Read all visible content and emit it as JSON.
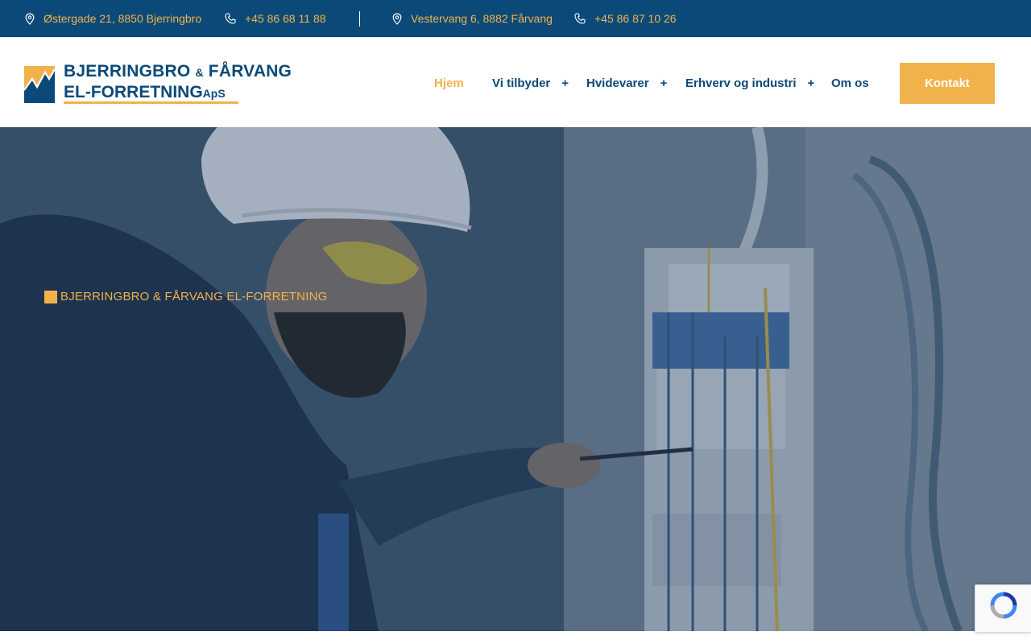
{
  "topbar": {
    "address1": "Østergade 21, 8850 Bjerringbro",
    "phone1": "+45 86 68 11 88",
    "address2": "Vestervang 6, 8882 Fårvang",
    "phone2": "+45 86 87 10 26"
  },
  "logo": {
    "line1_main": "BJERRINGBRO",
    "line1_amp": "&",
    "line1_end": "FÅRVANG",
    "line2_main": "EL-FORRETNING",
    "line2_suffix": "ApS"
  },
  "nav": {
    "items": [
      {
        "label": "Hjem",
        "active": true
      },
      {
        "label": "Vi tilbyder",
        "has_submenu": true
      },
      {
        "label": "Hvidevarer",
        "has_submenu": true
      },
      {
        "label": "Erhverv og industri",
        "has_submenu": true
      },
      {
        "label": "Om os"
      }
    ],
    "plus_symbol": "+",
    "cta_label": "Kontakt"
  },
  "hero": {
    "eyebrow": "BJERRINGBRO & FÅRVANG EL-FORRETNING"
  },
  "colors": {
    "brand_blue": "#0b4a78",
    "accent_orange": "#f2b24b"
  },
  "icons": [
    "map-pin-icon",
    "phone-icon",
    "logo-mark-icon",
    "recaptcha-icon"
  ]
}
